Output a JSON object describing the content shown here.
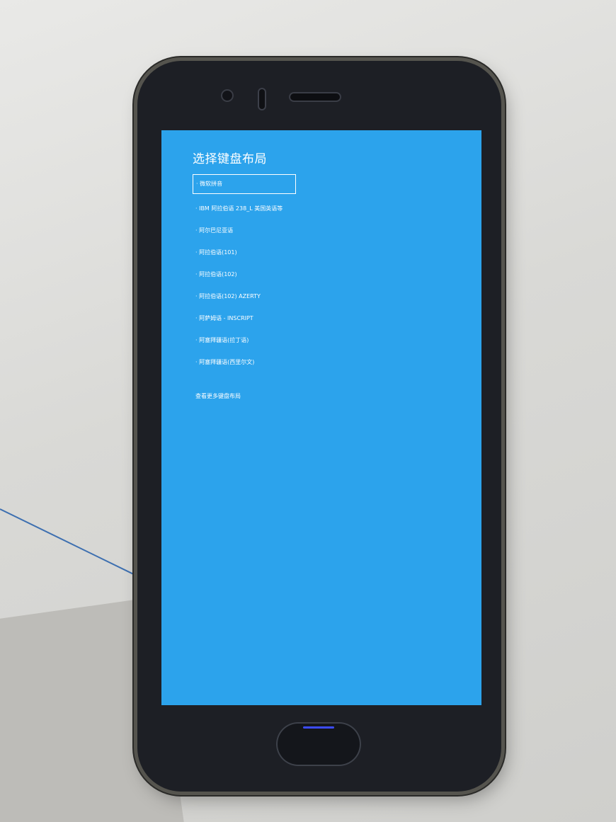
{
  "screen": {
    "title": "选择键盘布局",
    "layouts": [
      "· 微软拼音",
      "· IBM 阿拉伯语 238_L 美国英语等",
      "· 阿尔巴尼亚语",
      "· 阿拉伯语(101)",
      "· 阿拉伯语(102)",
      "· 阿拉伯语(102) AZERTY",
      "· 阿萨姆语 - INSCRIPT",
      "· 阿塞拜疆语(拉丁语)",
      "· 阿塞拜疆语(西里尔文)"
    ],
    "selected_index": 0,
    "more_link": "查看更多键盘布局"
  },
  "colors": {
    "screen_bg": "#2ca3ec",
    "text": "#ffffff"
  }
}
